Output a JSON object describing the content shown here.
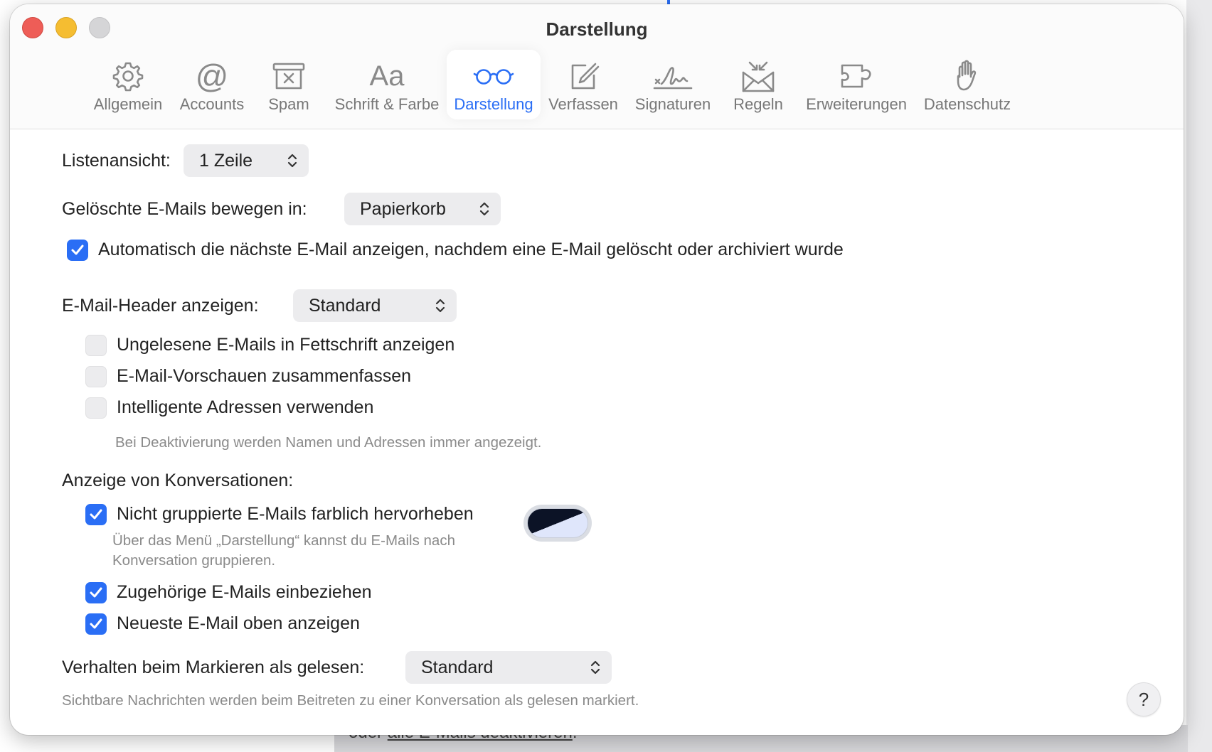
{
  "window": {
    "title": "Darstellung"
  },
  "tabs": [
    {
      "id": "allgemein",
      "label": "Allgemein",
      "icon": "gear-icon"
    },
    {
      "id": "accounts",
      "label": "Accounts",
      "icon": "at-icon"
    },
    {
      "id": "spam",
      "label": "Spam",
      "icon": "junk-box-icon"
    },
    {
      "id": "schrift",
      "label": "Schrift & Farbe",
      "icon": "font-icon",
      "glyph": "Aa"
    },
    {
      "id": "darstellung",
      "label": "Darstellung",
      "icon": "glasses-icon",
      "active": true
    },
    {
      "id": "verfassen",
      "label": "Verfassen",
      "icon": "compose-icon"
    },
    {
      "id": "signaturen",
      "label": "Signaturen",
      "icon": "signature-icon"
    },
    {
      "id": "regeln",
      "label": "Regeln",
      "icon": "rules-envelope-icon"
    },
    {
      "id": "erweiterungen",
      "label": "Erweiterungen",
      "icon": "puzzle-icon"
    },
    {
      "id": "datenschutz",
      "label": "Datenschutz",
      "icon": "hand-icon"
    }
  ],
  "settings": {
    "list_view": {
      "label": "Listenansicht:",
      "value": "1 Zeile"
    },
    "deleted_move": {
      "label": "Gelöschte E-Mails bewegen in:",
      "value": "Papierkorb"
    },
    "auto_next": {
      "label": "Automatisch die nächste E-Mail anzeigen, nachdem eine E-Mail gelöscht oder archiviert wurde",
      "checked": true
    },
    "header": {
      "label": "E-Mail-Header anzeigen:",
      "value": "Standard"
    },
    "unread_bold": {
      "label": "Ungelesene E-Mails in Fettschrift anzeigen",
      "checked": false
    },
    "preview_summary": {
      "label": "E-Mail-Vorschauen zusammenfassen",
      "checked": false
    },
    "smart_addresses": {
      "label": "Intelligente Adressen verwenden",
      "checked": false,
      "hint": "Bei Deaktivierung werden Namen und Adressen immer angezeigt."
    },
    "conversations_heading": "Anzeige von Konversationen:",
    "highlight_ungrouped": {
      "label": "Nicht gruppierte E-Mails farblich hervorheben",
      "checked": true,
      "hint_line1": "Über das Menü „Darstellung“ kannst du E-Mails nach",
      "hint_line2": "Konversation gruppieren."
    },
    "include_related": {
      "label": "Zugehörige E-Mails einbeziehen",
      "checked": true
    },
    "newest_top": {
      "label": "Neueste E-Mail oben anzeigen",
      "checked": true
    },
    "mark_read": {
      "label": "Verhalten beim Markieren als gelesen:",
      "value": "Standard",
      "hint": "Sichtbare Nachrichten werden beim Beitreten zu einer Konversation als gelesen markiert."
    },
    "help_label": "?"
  },
  "background": {
    "cut_text": "oder",
    "cut_link": "alle E-Mails deaktivieren",
    "cut_end": "."
  },
  "colors": {
    "accent": "#2a6ef5",
    "close": "#ee5d57",
    "minimize": "#f5bd31",
    "maximize": "#d5d5d7"
  }
}
